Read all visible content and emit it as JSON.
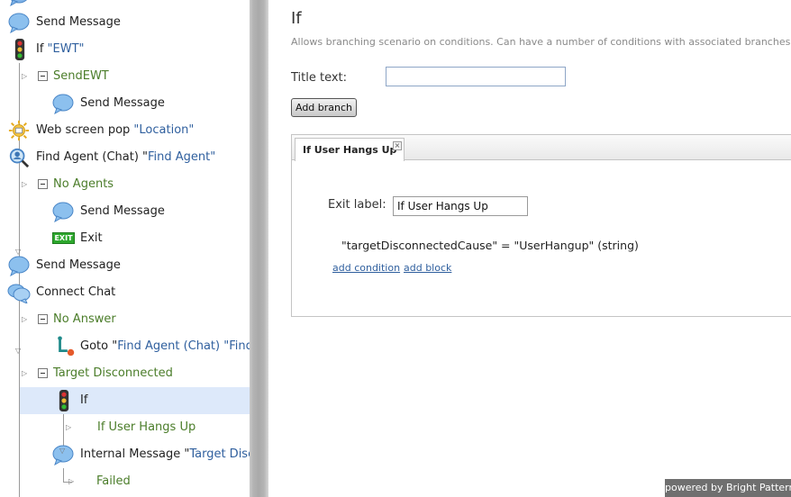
{
  "tree": {
    "nodes": [
      {
        "kind": "Send Message",
        "ref": ""
      },
      {
        "kind": "If ",
        "ref": "\"EWT\""
      },
      {
        "kind": "SendEWT",
        "ref": ""
      },
      {
        "kind": "Send Message",
        "ref": ""
      },
      {
        "kind": "Web screen pop ",
        "ref": "\"Location\""
      },
      {
        "kind": "Find Agent (Chat) \"",
        "ref": "Find Agent\""
      },
      {
        "kind": "No Agents",
        "ref": ""
      },
      {
        "kind": "Send Message",
        "ref": ""
      },
      {
        "kind": "Exit",
        "ref": ""
      },
      {
        "kind": "Send Message",
        "ref": ""
      },
      {
        "kind": "Connect Chat",
        "ref": ""
      },
      {
        "kind": "No Answer",
        "ref": ""
      },
      {
        "kind": "Goto \"",
        "ref": "Find Agent (Chat) \"Find"
      },
      {
        "kind": "Target Disconnected",
        "ref": ""
      },
      {
        "kind": "If",
        "ref": ""
      },
      {
        "kind": "If User Hangs Up",
        "ref": ""
      },
      {
        "kind": "Internal Message \"",
        "ref": "Target Disc"
      },
      {
        "kind": "Failed",
        "ref": ""
      }
    ],
    "exit_icon_text": "EXIT"
  },
  "panel": {
    "title": "If",
    "description": "Allows branching scenario on conditions. Can have a number of conditions with associated branches.",
    "title_text_label": "Title text:",
    "title_text_value": "",
    "add_branch_label": "Add branch",
    "tabs": [
      {
        "label": "If User Hangs Up",
        "close": "×"
      }
    ],
    "exit_label_label": "Exit label:",
    "exit_label_value": "If User Hangs Up",
    "condition": "\"targetDisconnectedCause\" = \"UserHangup\" (string)",
    "add_condition_label": "add condition",
    "add_block_label": "add block"
  },
  "footer": {
    "powered_by": "powered by Bright Pattern"
  },
  "colors": {
    "selection": "#dde9fa",
    "link": "#2f5f9e",
    "branch": "#4b7d2a",
    "splitter": "#b4b4b4"
  }
}
